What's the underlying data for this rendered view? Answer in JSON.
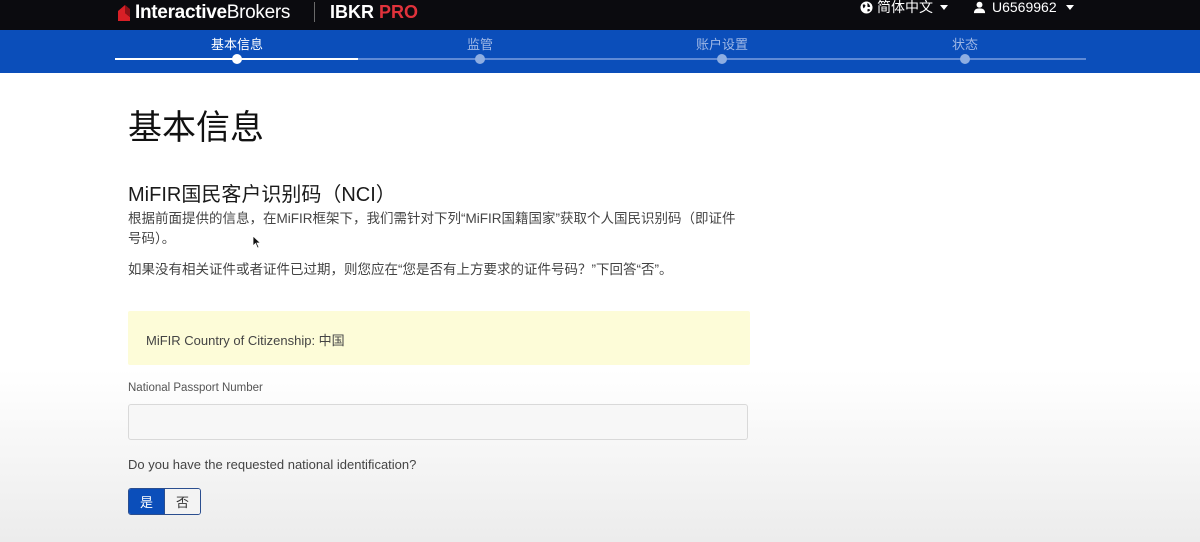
{
  "header": {
    "logo_bold": "Interactive",
    "logo_light": "Brokers",
    "product_prefix": "IBKR",
    "product_suffix": "PRO",
    "language": "简体中文",
    "user_id": "U6569962",
    "icons": {
      "language": "globe-icon",
      "user": "user-icon",
      "logo": "ib-logo-icon"
    }
  },
  "steps": [
    {
      "label": "基本信息",
      "active": true
    },
    {
      "label": "监管",
      "active": false
    },
    {
      "label": "账户设置",
      "active": false
    },
    {
      "label": "状态",
      "active": false
    }
  ],
  "main": {
    "title": "基本信息",
    "section_title": "MiFIR国民客户识别码（NCI）",
    "paragraph1": "根据前面提供的信息，在MiFIR框架下，我们需针对下列“MiFIR国籍国家”获取个人国民识别码（即证件号码）。",
    "paragraph2": "如果没有相关证件或者证件已过期，则您应在“您是否有上方要求的证件号码？”下回答“否”。",
    "notice": "MiFIR Country of Citizenship: 中国",
    "passport_label": "National Passport Number",
    "passport_value": "",
    "question": "Do you have the requested national identification?",
    "yes_label": "是",
    "no_label": "否",
    "selected": "是"
  },
  "colors": {
    "topbar": "#0b0b0f",
    "stepbar": "#0b4eba",
    "accent_red": "#e0323b",
    "notice_bg": "#fdfcd8"
  }
}
